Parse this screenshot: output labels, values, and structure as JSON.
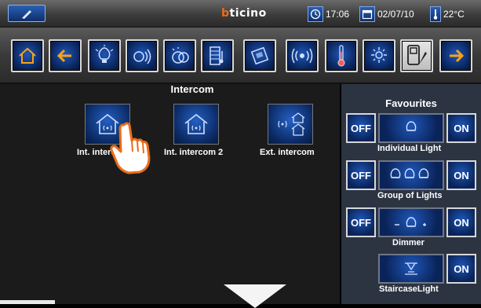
{
  "topbar": {
    "brand_prefix": "b",
    "brand_rest": "ticino",
    "time": "17:06",
    "date": "02/07/10",
    "temperature": "22°C"
  },
  "toolbar": {
    "icons": [
      "home-icon",
      "back-arrow-icon",
      "light-bulb-icon",
      "automation-icon",
      "scenario-icon",
      "multimedia-icon",
      "intercom-icon",
      "sound-icon",
      "thermometer-icon",
      "energy-icon",
      "intercom-video-icon",
      "forward-arrow-icon"
    ]
  },
  "main": {
    "title": "Intercom",
    "items": [
      {
        "label": "Int. intercom"
      },
      {
        "label": "Int. intercom 2"
      },
      {
        "label": "Ext. intercom"
      }
    ]
  },
  "favourites": {
    "title": "Favourites",
    "rows": [
      {
        "off": "OFF",
        "on": "ON",
        "label": "Individual Light"
      },
      {
        "off": "OFF",
        "on": "ON",
        "label": "Group of Lights"
      },
      {
        "off": "OFF",
        "on": "ON",
        "label": "Dimmer"
      },
      {
        "on": "ON",
        "label": "StaircaseLight"
      }
    ]
  },
  "colors": {
    "accent_blue": "#1e56b8",
    "brand_orange": "#f06a1a",
    "panel_bg": "#2c3442"
  }
}
